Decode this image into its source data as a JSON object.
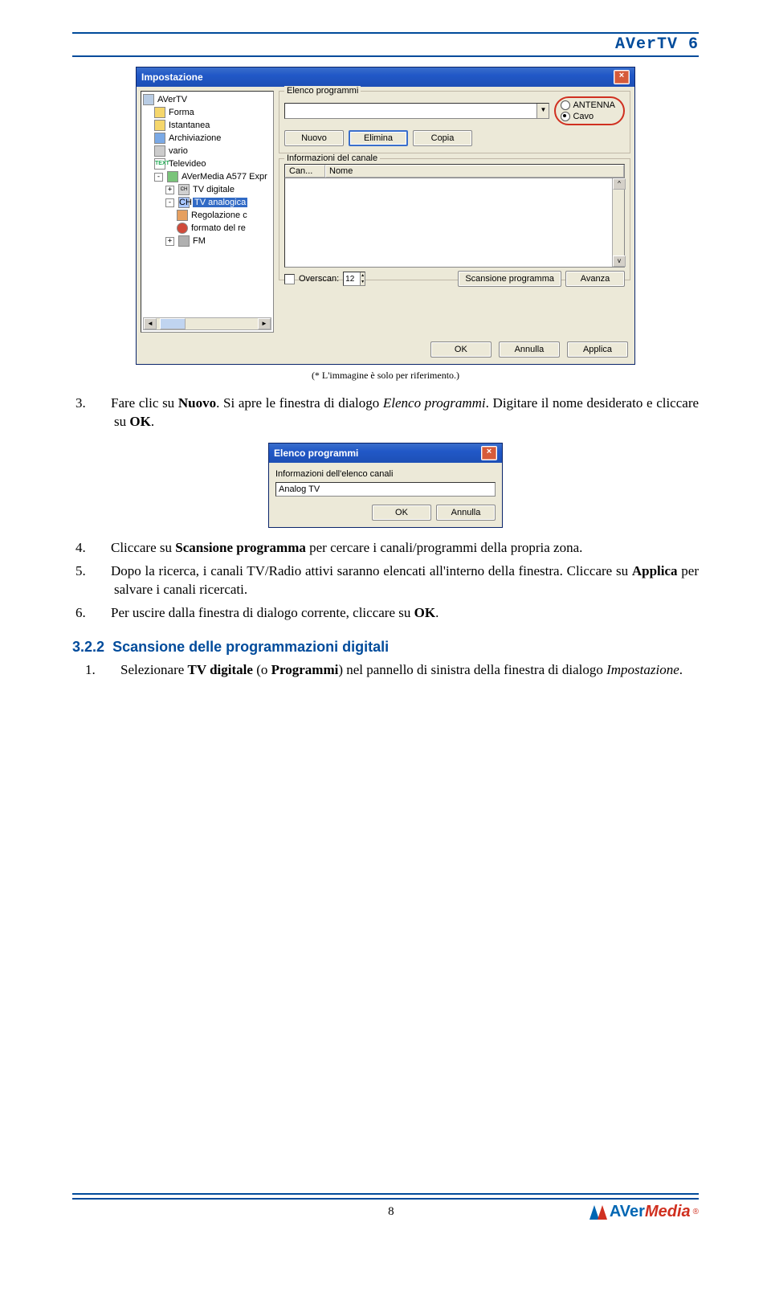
{
  "header": {
    "title": "AVerTV 6"
  },
  "dialog1": {
    "title": "Impostazione",
    "tree": {
      "items": [
        {
          "label": "AVerTV",
          "icon": "avertv",
          "ind": 0
        },
        {
          "label": "Forma",
          "icon": "yellow",
          "ind": 1
        },
        {
          "label": "Istantanea",
          "icon": "yellow",
          "ind": 1
        },
        {
          "label": "Archiviazione",
          "icon": "blue",
          "ind": 1
        },
        {
          "label": "vario",
          "icon": "",
          "ind": 1
        },
        {
          "label": "Televideo",
          "icon": "text",
          "ind": 1,
          "icontext": "TEXT"
        },
        {
          "label": "AVerMedia A577 Expr",
          "icon": "green",
          "ind": 1,
          "expander": "-"
        },
        {
          "label": "TV digitale",
          "icon": "tv",
          "ind": 2,
          "expander": "+",
          "icontext": "CH"
        },
        {
          "label": "TV analogica",
          "icon": "anal",
          "ind": 2,
          "expander": "-",
          "selected": true,
          "icontext": "CH"
        },
        {
          "label": "Regolazione c",
          "icon": "orange",
          "ind": 3
        },
        {
          "label": "formato del re",
          "icon": "red",
          "ind": 3
        },
        {
          "label": "FM",
          "icon": "fm",
          "ind": 2,
          "expander": "+"
        }
      ]
    },
    "fieldset1": {
      "legend": "Elenco programmi",
      "radios": {
        "antenna": "ANTENNA",
        "cavo": "Cavo",
        "selected": "cavo"
      },
      "buttons": {
        "nuovo": "Nuovo",
        "elimina": "Elimina",
        "copia": "Copia"
      }
    },
    "fieldset2": {
      "legend": "Informazioni del canale",
      "headers": {
        "can": "Can...",
        "nome": "Nome"
      },
      "overscan": "Overscan:",
      "overscan_val": "12",
      "scan": "Scansione programma",
      "avanza": "Avanza"
    },
    "bottom": {
      "ok": "OK",
      "annulla": "Annulla",
      "applica": "Applica"
    }
  },
  "caption1": "(* L'immagine è solo per riferimento.)",
  "steps": {
    "s3": {
      "n": "3.",
      "pre": "Fare clic su ",
      "b1": "Nuovo",
      "mid": ". Si apre le finestra di dialogo ",
      "i1": "Elenco programmi",
      "post": ". Digitare il nome desiderato e cliccare su ",
      "b2": "OK",
      "end": "."
    },
    "s4": {
      "n": "4.",
      "pre": "Cliccare su ",
      "b1": "Scansione programma",
      "post": " per cercare i canali/programmi della propria zona."
    },
    "s5": {
      "n": "5.",
      "pre": "Dopo la ricerca, i canali TV/Radio attivi saranno elencati all'interno della finestra. Cliccare su ",
      "b1": "Applica",
      "post": " per salvare i canali ricercati."
    },
    "s6": {
      "n": "6.",
      "pre": "Per uscire dalla finestra di dialogo corrente, cliccare su ",
      "b1": "OK",
      "post": "."
    }
  },
  "dialog2": {
    "title": "Elenco programmi",
    "label": "Informazioni dell'elenco canali",
    "value": "Analog TV",
    "ok": "OK",
    "annulla": "Annulla"
  },
  "section": {
    "num": "3.2.2",
    "title": "Scansione delle programmazioni digitali",
    "item1": {
      "n": "1.",
      "pre": "Selezionare ",
      "b1": "TV digitale",
      "mid": " (o ",
      "b2": "Programmi",
      "mid2": ") nel pannello di sinistra della finestra di dialogo ",
      "i1": "Impostazione",
      "post": "."
    }
  },
  "footer": {
    "page": "8",
    "brand1": "AVer",
    "brand2": "Media"
  }
}
